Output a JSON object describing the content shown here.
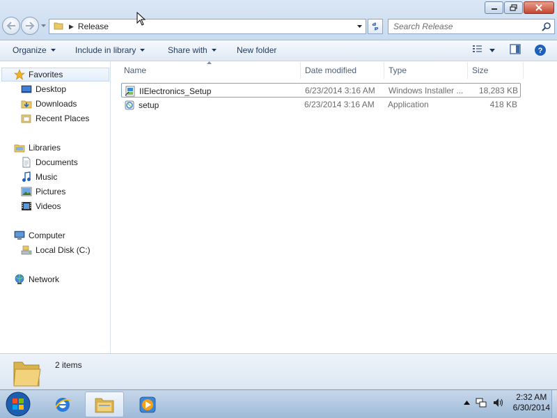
{
  "address": {
    "path": "Release"
  },
  "search": {
    "placeholder": "Search Release"
  },
  "toolbar": {
    "organize": "Organize",
    "include_in_library": "Include in library",
    "share_with": "Share with",
    "new_folder": "New folder"
  },
  "sidebar": {
    "favorites": {
      "label": "Favorites",
      "items": [
        "Desktop",
        "Downloads",
        "Recent Places"
      ]
    },
    "libraries": {
      "label": "Libraries",
      "items": [
        "Documents",
        "Music",
        "Pictures",
        "Videos"
      ]
    },
    "computer": {
      "label": "Computer",
      "items": [
        "Local Disk (C:)"
      ]
    },
    "network": {
      "label": "Network"
    }
  },
  "columns": {
    "name": "Name",
    "date": "Date modified",
    "type": "Type",
    "size": "Size"
  },
  "files": [
    {
      "name": "IIElectronics_Setup",
      "date": "6/23/2014 3:16 AM",
      "type": "Windows Installer ...",
      "size": "18,283 KB",
      "icon": "msi-installer-icon"
    },
    {
      "name": "setup",
      "date": "6/23/2014 3:16 AM",
      "type": "Application",
      "size": "418 KB",
      "icon": "setup-exe-icon"
    }
  ],
  "details": {
    "count": "2 items"
  },
  "taskbar": {
    "time": "2:32 AM",
    "date": "6/30/2014",
    "apps": [
      "internet-explorer-icon",
      "windows-explorer-icon",
      "media-player-icon"
    ]
  },
  "colors": {
    "accent": "#1e395b",
    "selection_border": "#7da2ce",
    "close_button": "#c54530"
  }
}
